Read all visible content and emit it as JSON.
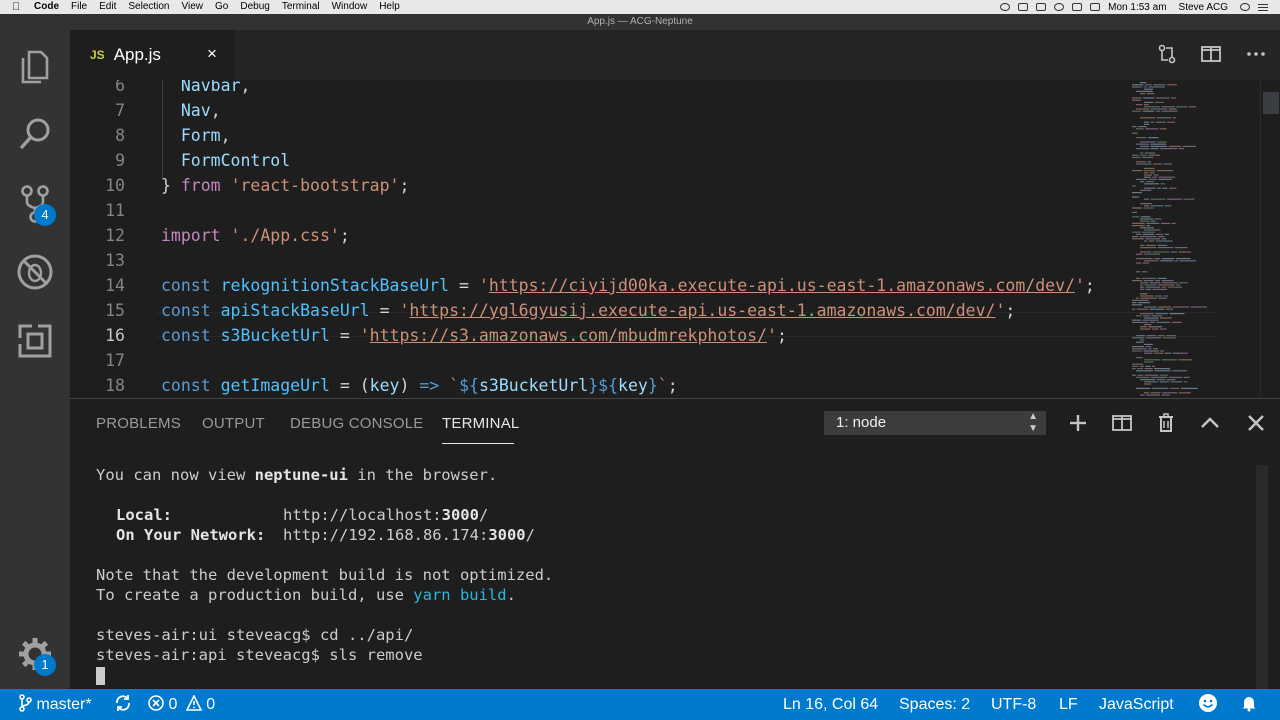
{
  "menubar": {
    "app_name": "Code",
    "items": [
      "File",
      "Edit",
      "Selection",
      "View",
      "Go",
      "Debug",
      "Terminal",
      "Window",
      "Help"
    ],
    "clock": "Mon 1:53 am",
    "user": "Steve ACG"
  },
  "window": {
    "title": "App.js — ACG-Neptune"
  },
  "activity_bar": {
    "items": [
      {
        "icon": "files-icon"
      },
      {
        "icon": "search-icon"
      },
      {
        "icon": "source-control-icon",
        "badge": "4"
      },
      {
        "icon": "debug-icon"
      },
      {
        "icon": "extensions-icon"
      }
    ],
    "settings_badge": "1"
  },
  "tab": {
    "file_type": "JS",
    "name": "App.js",
    "close": "×"
  },
  "editor": {
    "active_line": 16,
    "lines": [
      {
        "n": "6",
        "text": "  Navbar,"
      },
      {
        "n": "7",
        "text": "  Nav,"
      },
      {
        "n": "8",
        "text": "  Form,"
      },
      {
        "n": "9",
        "text": "  FormControl"
      },
      {
        "n": "10",
        "text": "} from 'react-bootstrap';"
      },
      {
        "n": "11",
        "text": ""
      },
      {
        "n": "12",
        "text": "import './App.css';"
      },
      {
        "n": "13",
        "text": ""
      },
      {
        "n": "14",
        "text": "const rekognitionStackBaseUrl = 'https://ciyijd00ka.execute-api.us-east-1.amazonaws.com/dev/';"
      },
      {
        "n": "15",
        "text": "const apiStackBaseUrl = 'https://ygl6gyusij.execute-api.us-east-1.amazonaws.com/dev/';"
      },
      {
        "n": "16",
        "text": "const s3BucketUrl = 'https://s3.amazonaws.com/mbudmrekphotos/';"
      },
      {
        "n": "17",
        "text": ""
      },
      {
        "n": "18",
        "text": "const getImageUrl = (key) => `${s3BucketUrl}${key}`;"
      }
    ]
  },
  "panel": {
    "tabs": [
      "PROBLEMS",
      "OUTPUT",
      "DEBUG CONSOLE",
      "TERMINAL"
    ],
    "active_tab": "TERMINAL",
    "terminal_select": "1: node",
    "terminal": {
      "l1_pre": "You can now view ",
      "l1_app": "neptune-ui",
      "l1_post": " in the browser.",
      "local_label": "Local:",
      "local_url_a": "http://localhost:",
      "local_url_port": "3000",
      "local_url_b": "/",
      "network_label": "On Your Network:",
      "network_url_a": "http://192.168.86.174:",
      "network_url_port": "3000",
      "network_url_b": "/",
      "note": "Note that the development build is not optimized.",
      "prod_pre": "To create a production build, use ",
      "prod_cmd": "yarn build",
      "prod_post": ".",
      "cmd1": "steves-air:ui steveacg$ cd ../api/",
      "cmd2": "steves-air:api steveacg$ sls remove"
    }
  },
  "statusbar": {
    "branch": "master*",
    "errors": "0",
    "warnings": "0",
    "position": "Ln 16, Col 64",
    "spaces": "Spaces: 2",
    "encoding": "UTF-8",
    "eol": "LF",
    "language": "JavaScript"
  },
  "colors": {
    "accent": "#007acc",
    "keyword": "#569cd6",
    "string": "#ce9178",
    "variable": "#9cdcfe",
    "control": "#c586c0"
  }
}
